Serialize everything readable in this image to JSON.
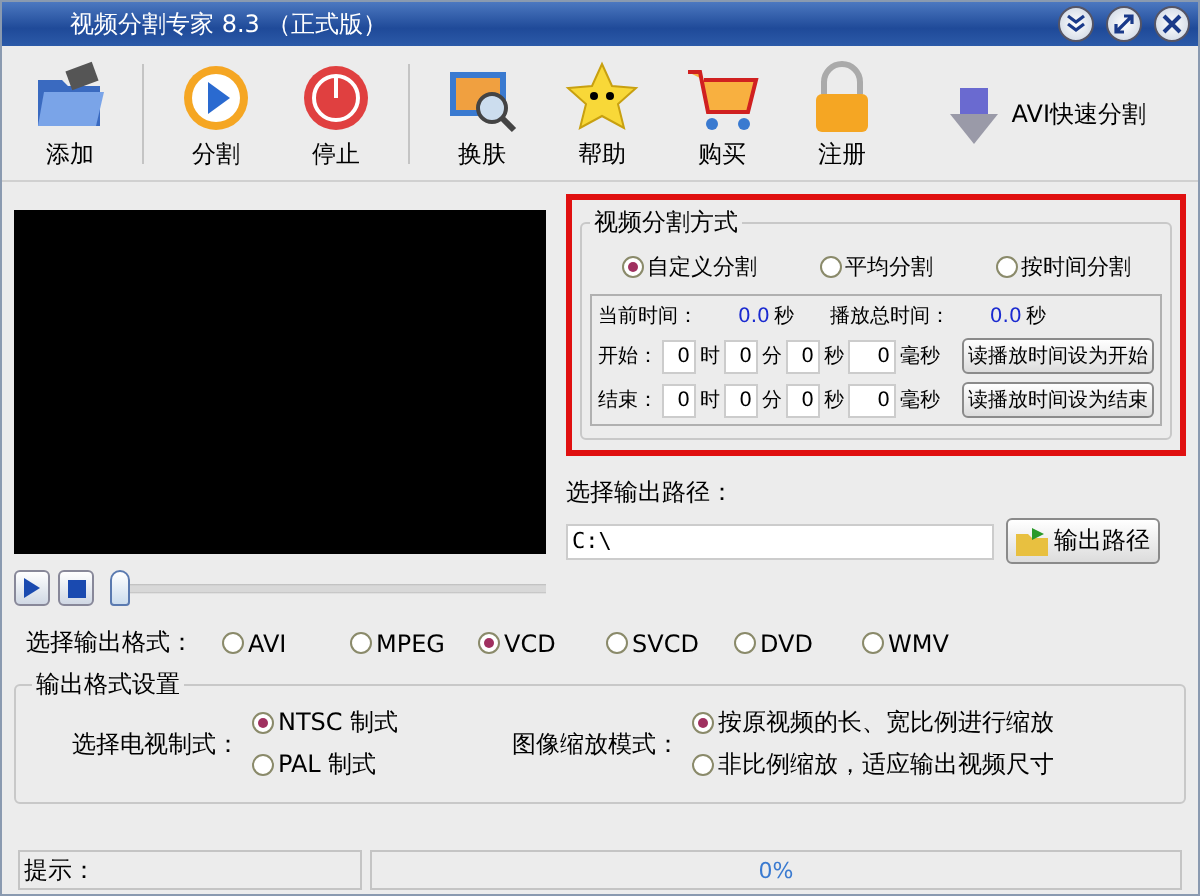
{
  "window": {
    "title": "视频分割专家 8.3 （正式版）"
  },
  "toolbar": [
    {
      "label": "添加",
      "kind": "folder"
    },
    {
      "label": "分割",
      "kind": "play"
    },
    {
      "label": "停止",
      "kind": "stop"
    },
    {
      "label": "换肤",
      "kind": "skin"
    },
    {
      "label": "帮助",
      "kind": "star"
    },
    {
      "label": "购买",
      "kind": "cart"
    },
    {
      "label": "注册",
      "kind": "lock"
    }
  ],
  "avi_button": "AVI快速分割",
  "split_mode": {
    "title": "视频分割方式",
    "options": [
      {
        "label": "自定义分割",
        "selected": true
      },
      {
        "label": "平均分割",
        "selected": false
      },
      {
        "label": "按时间分割",
        "selected": false
      }
    ],
    "times": [
      {
        "label": "当前时间：",
        "value": "0.0",
        "unit": "秒"
      },
      {
        "label": "播放总时间：",
        "value": "0.0",
        "unit": "秒"
      }
    ],
    "ranges": [
      {
        "label": "开始：",
        "fields": [
          {
            "value": "0",
            "unit": "时"
          },
          {
            "value": "0",
            "unit": "分"
          },
          {
            "value": "0",
            "unit": "秒"
          },
          {
            "value": "0",
            "unit": "毫秒"
          }
        ],
        "button": "读播放时间设为开始"
      },
      {
        "label": "结束：",
        "fields": [
          {
            "value": "0",
            "unit": "时"
          },
          {
            "value": "0",
            "unit": "分"
          },
          {
            "value": "0",
            "unit": "秒"
          },
          {
            "value": "0",
            "unit": "毫秒"
          }
        ],
        "button": "读播放时间设为结束"
      }
    ]
  },
  "output_path": {
    "label": "选择输出路径：",
    "value": "C:\\",
    "button": "输出路径"
  },
  "player": {
    "level": 0
  },
  "format": {
    "label": "选择输出格式：",
    "options": [
      {
        "label": "AVI",
        "selected": false
      },
      {
        "label": "MPEG",
        "selected": false
      },
      {
        "label": "VCD",
        "selected": true
      },
      {
        "label": "SVCD",
        "selected": false
      },
      {
        "label": "DVD",
        "selected": false
      },
      {
        "label": "WMV",
        "selected": false
      }
    ]
  },
  "settings": {
    "title": "输出格式设置",
    "tv": {
      "label": "选择电视制式：",
      "options": [
        {
          "label": "NTSC 制式",
          "selected": true
        },
        {
          "label": "PAL  制式",
          "selected": false
        }
      ]
    },
    "scale": {
      "label": "图像缩放模式：",
      "options": [
        {
          "label": "按原视频的长、宽比例进行缩放",
          "selected": true
        },
        {
          "label": "非比例缩放，适应输出视频尺寸",
          "selected": false
        }
      ]
    }
  },
  "status": {
    "label": "提示：",
    "progress": "0%",
    "level": 0
  }
}
